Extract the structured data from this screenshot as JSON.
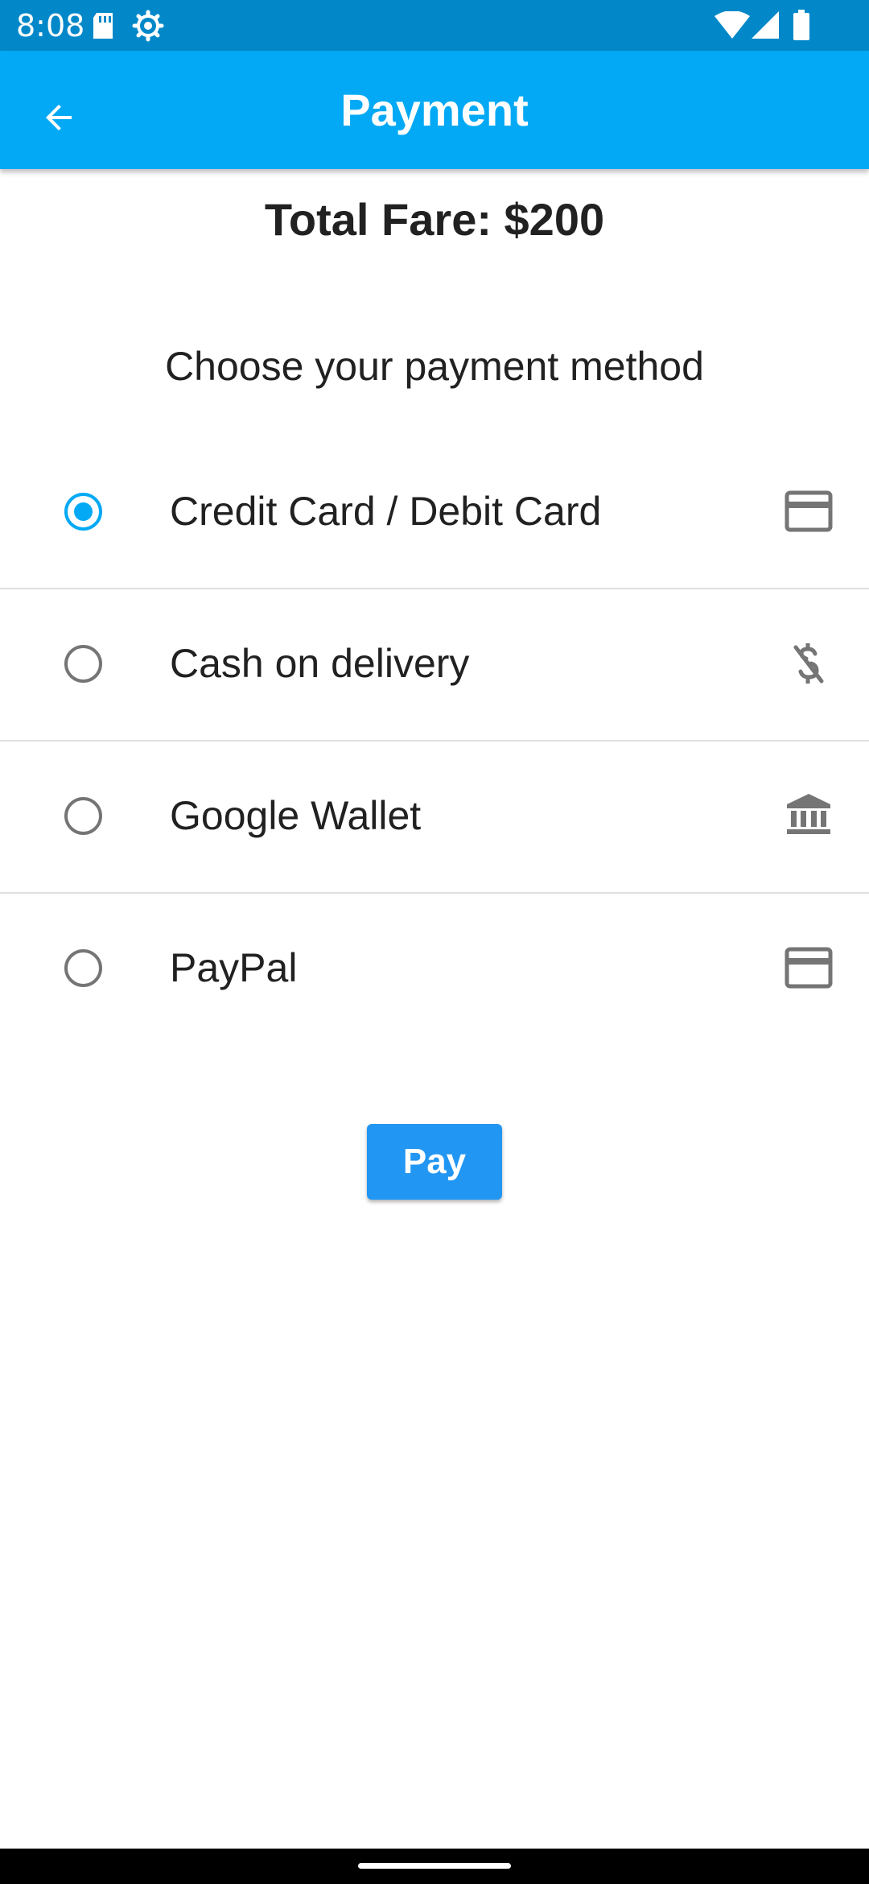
{
  "status_bar": {
    "time": "8:08",
    "icons": [
      "sd-card-icon",
      "settings-icon",
      "wifi-icon",
      "signal-icon",
      "battery-icon"
    ]
  },
  "app_bar": {
    "title": "Payment",
    "back_icon": "arrow-back-icon"
  },
  "summary": {
    "total_fare": "Total Fare: $200"
  },
  "prompt": {
    "text": "Choose your payment method"
  },
  "payment_options": [
    {
      "label": "Credit Card / Debit Card",
      "icon": "credit-card-icon",
      "selected": true
    },
    {
      "label": "Cash on delivery",
      "icon": "money-off-icon",
      "selected": false
    },
    {
      "label": "Google Wallet",
      "icon": "bank-icon",
      "selected": false
    },
    {
      "label": "PayPal",
      "icon": "credit-card-icon",
      "selected": false
    }
  ],
  "actions": {
    "pay_label": "Pay"
  },
  "colors": {
    "status_bar": "#0288c9",
    "app_bar": "#03a9f4",
    "accent": "#03a9f4",
    "button": "#2196f3"
  }
}
